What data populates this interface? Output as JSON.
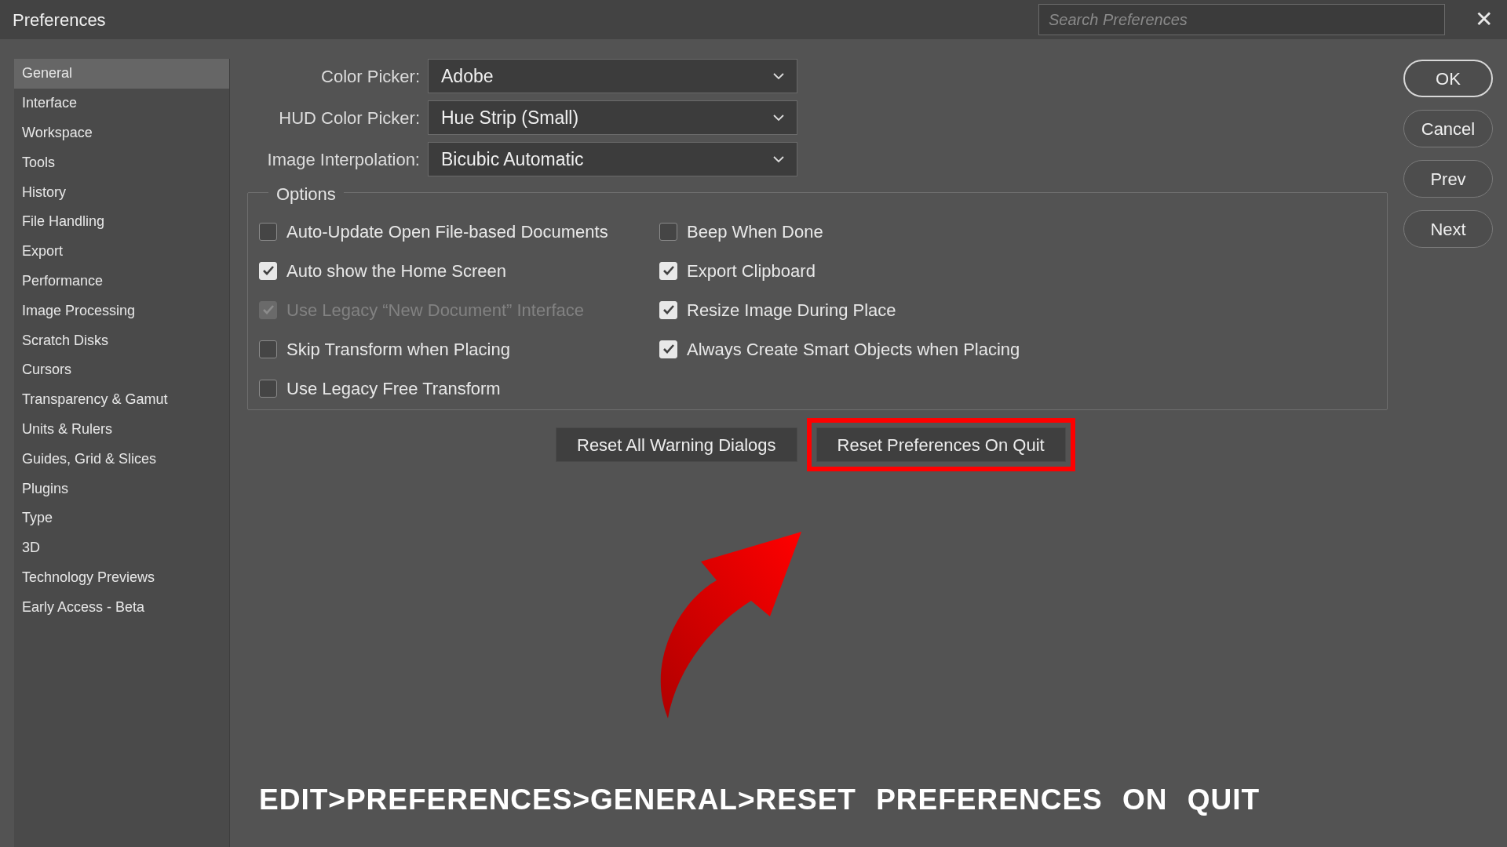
{
  "window": {
    "title": "Preferences"
  },
  "search": {
    "placeholder": "Search Preferences"
  },
  "close": {
    "glyph": "✕"
  },
  "sidebar": {
    "items": [
      {
        "label": "General",
        "selected": true
      },
      {
        "label": "Interface",
        "selected": false
      },
      {
        "label": "Workspace",
        "selected": false
      },
      {
        "label": "Tools",
        "selected": false
      },
      {
        "label": "History",
        "selected": false
      },
      {
        "label": "File Handling",
        "selected": false
      },
      {
        "label": "Export",
        "selected": false
      },
      {
        "label": "Performance",
        "selected": false
      },
      {
        "label": "Image Processing",
        "selected": false
      },
      {
        "label": "Scratch Disks",
        "selected": false
      },
      {
        "label": "Cursors",
        "selected": false
      },
      {
        "label": "Transparency & Gamut",
        "selected": false
      },
      {
        "label": "Units & Rulers",
        "selected": false
      },
      {
        "label": "Guides, Grid & Slices",
        "selected": false
      },
      {
        "label": "Plugins",
        "selected": false
      },
      {
        "label": "Type",
        "selected": false
      },
      {
        "label": "3D",
        "selected": false
      },
      {
        "label": "Technology Previews",
        "selected": false
      },
      {
        "label": "Early Access - Beta",
        "selected": false
      }
    ]
  },
  "dropdowns": [
    {
      "label": "Color Picker:",
      "value": "Adobe"
    },
    {
      "label": "HUD Color Picker:",
      "value": "Hue Strip (Small)"
    },
    {
      "label": "Image Interpolation:",
      "value": "Bicubic Automatic"
    }
  ],
  "options": {
    "title": "Options",
    "columns": [
      [
        {
          "label": "Auto-Update Open File-based Documents",
          "checked": false,
          "disabled": false
        },
        {
          "label": "Auto show the Home Screen",
          "checked": true,
          "disabled": false
        },
        {
          "label": "Use Legacy “New Document” Interface",
          "checked": true,
          "disabled": true
        },
        {
          "label": "Skip Transform when Placing",
          "checked": false,
          "disabled": false
        },
        {
          "label": "Use Legacy Free Transform",
          "checked": false,
          "disabled": false
        }
      ],
      [
        {
          "label": "Beep When Done",
          "checked": false,
          "disabled": false
        },
        {
          "label": "Export Clipboard",
          "checked": true,
          "disabled": false
        },
        {
          "label": "Resize Image During Place",
          "checked": true,
          "disabled": false
        },
        {
          "label": "Always Create Smart Objects when Placing",
          "checked": true,
          "disabled": false
        }
      ]
    ]
  },
  "reset_buttons": [
    {
      "label": "Reset All Warning Dialogs",
      "highlighted": false
    },
    {
      "label": "Reset Preferences On Quit",
      "highlighted": true
    }
  ],
  "side_buttons": [
    {
      "label": "OK",
      "kind": "default"
    },
    {
      "label": "Cancel",
      "kind": "normal"
    },
    {
      "label": "Prev",
      "kind": "normal"
    },
    {
      "label": "Next",
      "kind": "normal"
    }
  ],
  "caption": "EDIT>PREFERENCES>GENERAL>RESET PREFERENCES ON QUIT"
}
